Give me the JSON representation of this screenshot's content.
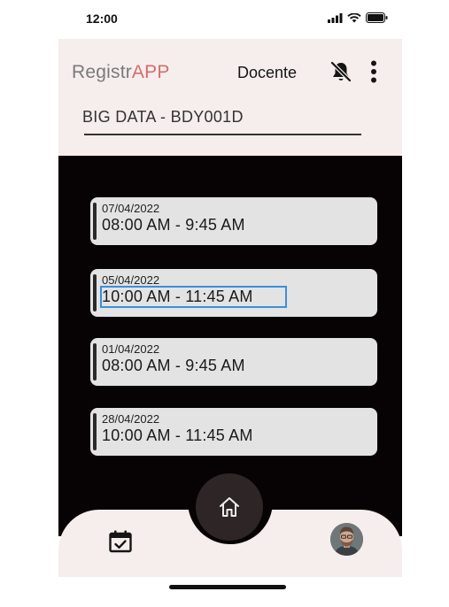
{
  "status_bar": {
    "time": "12:00"
  },
  "header": {
    "brand_primary": "Registr",
    "brand_accent": "APP",
    "role": "Docente",
    "course_value": "BIG DATA - BDY001D"
  },
  "classes": [
    {
      "date": "07/04/2022",
      "time": "08:00 AM - 9:45 AM"
    },
    {
      "date": "05/04/2022",
      "time": "10:00 AM - 11:45 AM"
    },
    {
      "date": "01/04/2022",
      "time": "08:00 AM - 9:45 AM"
    },
    {
      "date": "28/04/2022",
      "time": "10:00 AM - 11:45 AM"
    }
  ],
  "nav": {
    "icons": [
      "calendar-check-icon",
      "home-icon",
      "avatar"
    ]
  },
  "colors": {
    "header_bg": "#f6eeec",
    "main_bg": "#070304",
    "accent": "#d46d6d",
    "card_bg": "#e3e3e3"
  }
}
